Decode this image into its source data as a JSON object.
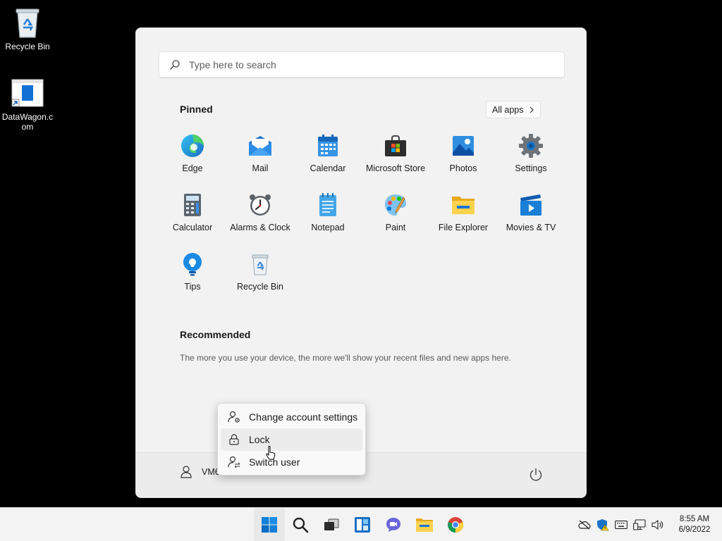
{
  "desktop": {
    "icons": [
      {
        "label": "Recycle Bin",
        "icon": "recycle-bin-icon"
      },
      {
        "label": "DataWagon.com",
        "icon": "datawagon-shortcut-icon"
      }
    ]
  },
  "start_menu": {
    "search": {
      "placeholder": "Type here to search",
      "value": ""
    },
    "pinned": {
      "title": "Pinned",
      "all_apps_label": "All apps",
      "apps": [
        {
          "label": "Edge",
          "icon": "edge-icon"
        },
        {
          "label": "Mail",
          "icon": "mail-icon"
        },
        {
          "label": "Calendar",
          "icon": "calendar-icon"
        },
        {
          "label": "Microsoft Store",
          "icon": "store-icon"
        },
        {
          "label": "Photos",
          "icon": "photos-icon"
        },
        {
          "label": "Settings",
          "icon": "settings-icon"
        },
        {
          "label": "Calculator",
          "icon": "calculator-icon"
        },
        {
          "label": "Alarms & Clock",
          "icon": "alarm-clock-icon"
        },
        {
          "label": "Notepad",
          "icon": "notepad-icon"
        },
        {
          "label": "Paint",
          "icon": "paint-icon"
        },
        {
          "label": "File Explorer",
          "icon": "file-explorer-icon"
        },
        {
          "label": "Movies & TV",
          "icon": "movies-tv-icon"
        },
        {
          "label": "Tips",
          "icon": "tips-icon"
        },
        {
          "label": "Recycle Bin",
          "icon": "recycle-bin-icon"
        }
      ]
    },
    "recommended": {
      "title": "Recommended",
      "text": "The more you use your device, the more we'll show your recent files and new apps here."
    },
    "footer": {
      "user_name": "VM6"
    }
  },
  "account_menu": {
    "items": [
      {
        "label": "Change account settings",
        "icon": "account-settings-icon"
      },
      {
        "label": "Lock",
        "icon": "lock-icon",
        "hovered": true
      },
      {
        "label": "Switch user",
        "icon": "switch-user-icon"
      }
    ]
  },
  "taskbar": {
    "apps": [
      "start-icon",
      "search-icon",
      "task-view-icon",
      "widgets-icon",
      "chat-icon",
      "file-explorer-icon",
      "chrome-icon"
    ],
    "tray": [
      "onedrive-offline-icon",
      "security-warning-icon",
      "keyboard-icon",
      "network-icon",
      "volume-icon"
    ],
    "time": "8:55 AM",
    "date": "6/9/2022"
  },
  "colors": {
    "accent": "#0067c0",
    "desktop_bg": "#000000",
    "start_bg": "#f2f2f2"
  }
}
